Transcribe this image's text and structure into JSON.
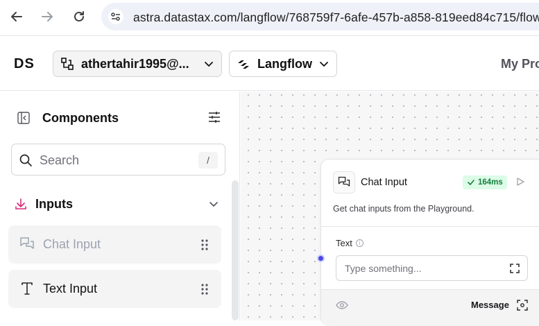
{
  "browser": {
    "url": "astra.datastax.com/langflow/768759f7-6afe-457b-a858-819eed84c715/flow/"
  },
  "header": {
    "logo": "DS",
    "org_label": "athertahir1995@...",
    "flow_label": "Langflow",
    "my_projects": "My Pro"
  },
  "sidebar": {
    "title": "Components",
    "search_placeholder": "Search",
    "search_shortcut": "/",
    "category": "Inputs",
    "items": [
      {
        "label": "Chat Input",
        "icon": "message-square-icon"
      },
      {
        "label": "Text Input",
        "icon": "type-icon"
      }
    ]
  },
  "node": {
    "title": "Chat Input",
    "badge": "164ms",
    "description": "Get chat inputs from the Playground.",
    "field_label": "Text",
    "field_placeholder": "Type something...",
    "output_label": "Message"
  },
  "colors": {
    "accent": "#4f46e5",
    "badge_bg": "#dcfce7",
    "badge_fg": "#15803d",
    "download_icon": "#db2777"
  }
}
